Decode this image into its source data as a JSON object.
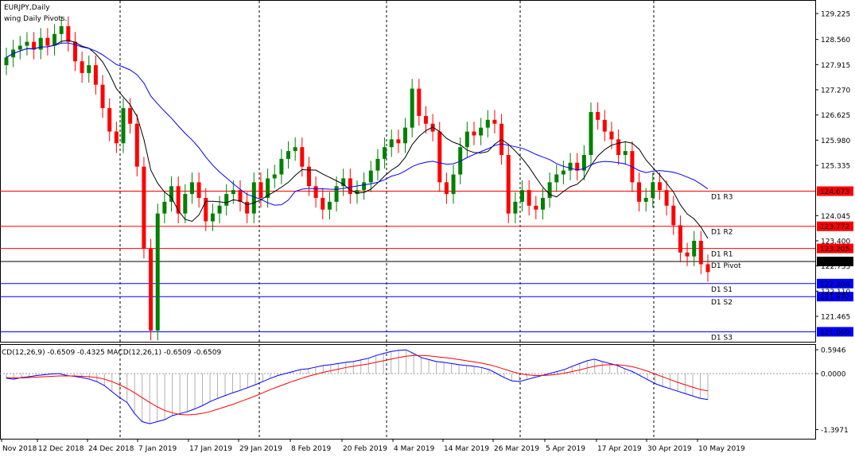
{
  "chart_data": [
    {
      "type": "candlestick",
      "title": "EURJPY,Daily",
      "subtitle": "wing Daily Pivots.",
      "price_axis": {
        "ticks": [
          "129.225",
          "128.560",
          "127.915",
          "127.270",
          "126.625",
          "125.980",
          "125.335",
          "124.045",
          "123.400",
          "122.755",
          "122.110",
          "121.465"
        ],
        "tick_values": [
          129.225,
          128.56,
          127.915,
          127.27,
          126.625,
          125.98,
          125.335,
          124.045,
          123.4,
          122.755,
          122.11,
          121.465
        ]
      },
      "date_axis": {
        "ticks": [
          "Nov 2018",
          "12 Dec 2018",
          "24 Dec 2018",
          "7 Jan 2019",
          "17 Jan 2019",
          "29 Jan 2019",
          "8 Feb 2019",
          "20 Feb 2019",
          "4 Mar 2019",
          "14 Mar 2019",
          "26 Mar 2019",
          "5 Apr 2019",
          "17 Apr 2019",
          "30 Apr 2019",
          "10 May 2019"
        ]
      },
      "pivot_levels": [
        {
          "name": "D1 R3",
          "value": 124.673,
          "price_label": "124.673",
          "color": "#ff0000"
        },
        {
          "name": "D1 R2",
          "value": 123.772,
          "price_label": "123.772",
          "color": "#ff0000"
        },
        {
          "name": "D1 R1",
          "value": 123.205,
          "price_label": "123.205",
          "color": "#ff0000"
        },
        {
          "name": "D1 Pivot",
          "value": 122.871,
          "price_label": "122.871",
          "color": "#000000"
        },
        {
          "name": "D1 S1",
          "value": 122.304,
          "price_label": "122.304",
          "color": "#0000ff"
        },
        {
          "name": "D1 S2",
          "value": 121.97,
          "price_label": "121.970",
          "color": "#0000ff"
        },
        {
          "name": "D1 S3",
          "value": 121.069,
          "price_label": "121.069",
          "color": "#0000ff"
        }
      ],
      "closes": [
        128.1,
        128.3,
        128.4,
        128.5,
        128.3,
        128.6,
        128.4,
        128.7,
        128.9,
        128.5,
        128.0,
        127.7,
        127.9,
        127.4,
        126.8,
        126.2,
        125.9,
        126.8,
        126.4,
        125.3,
        123.2,
        121.1,
        124.1,
        124.4,
        124.8,
        124.1,
        124.6,
        124.9,
        124.5,
        123.9,
        124.1,
        124.3,
        124.6,
        124.7,
        124.4,
        124.1,
        124.9,
        124.5,
        125.0,
        125.1,
        125.5,
        125.7,
        125.8,
        125.3,
        124.8,
        124.5,
        124.2,
        124.4,
        124.8,
        125.0,
        124.6,
        124.7,
        124.9,
        125.2,
        125.5,
        125.8,
        126.0,
        125.9,
        126.3,
        127.3,
        126.6,
        126.4,
        126.2,
        124.9,
        124.6,
        125.1,
        125.8,
        126.2,
        126.1,
        126.3,
        126.5,
        126.4,
        125.6,
        124.1,
        124.4,
        124.7,
        124.3,
        124.2,
        124.5,
        124.9,
        125.1,
        125.2,
        125.4,
        125.2,
        125.6,
        126.7,
        126.5,
        126.2,
        126.0,
        125.6,
        125.7,
        124.9,
        124.4,
        124.5,
        124.9,
        124.7,
        124.3,
        123.8,
        123.1,
        123.0,
        123.4,
        122.8,
        122.6
      ]
    },
    {
      "type": "macd",
      "header": "CD(12,26,9) -0.6509 -0.4325 MACD(12,26,1) -0.6509 -0.6509",
      "axis": {
        "ticks": [
          "0.5946",
          "0.0000",
          "-1.3971"
        ],
        "tick_values": [
          0.5946,
          0.0,
          -1.3971
        ]
      },
      "macd_line_color": "#0000ff",
      "signal_line_color": "#ff0000",
      "histogram": [
        -0.12,
        -0.14,
        -0.1,
        -0.08,
        -0.05,
        -0.03,
        -0.01,
        0.0,
        -0.05,
        -0.07,
        -0.1,
        -0.14,
        -0.2,
        -0.3,
        -0.45,
        -0.6,
        -0.72,
        -1.0,
        -1.2,
        -1.25,
        -1.2,
        -1.15,
        -1.05,
        -1.0,
        -0.95,
        -0.88,
        -0.8,
        -0.7,
        -0.62,
        -0.55,
        -0.48,
        -0.42,
        -0.35,
        -0.28,
        -0.2,
        -0.12,
        -0.05,
        0.0,
        0.05,
        0.1,
        0.12,
        0.16,
        0.2,
        0.22,
        0.25,
        0.28,
        0.3,
        0.34,
        0.38,
        0.45,
        0.5,
        0.55,
        0.58,
        0.59,
        0.5,
        0.4,
        0.35,
        0.3,
        0.28,
        0.25,
        0.22,
        0.2,
        0.18,
        0.15,
        0.1,
        0.0,
        -0.1,
        -0.18,
        -0.2,
        -0.15,
        -0.1,
        -0.05,
        0.0,
        0.05,
        0.1,
        0.18,
        0.25,
        0.32,
        0.36,
        0.3,
        0.25,
        0.2,
        0.12,
        0.05,
        -0.05,
        -0.15,
        -0.25,
        -0.32,
        -0.38,
        -0.44,
        -0.5,
        -0.56,
        -0.62,
        -0.65
      ],
      "macd": [
        -0.12,
        -0.14,
        -0.1,
        -0.08,
        -0.05,
        -0.03,
        -0.01,
        0.0,
        -0.05,
        -0.07,
        -0.1,
        -0.14,
        -0.2,
        -0.3,
        -0.45,
        -0.6,
        -0.72,
        -1.0,
        -1.2,
        -1.25,
        -1.2,
        -1.15,
        -1.05,
        -1.0,
        -0.95,
        -0.88,
        -0.8,
        -0.7,
        -0.62,
        -0.55,
        -0.48,
        -0.42,
        -0.35,
        -0.28,
        -0.2,
        -0.12,
        -0.05,
        0.0,
        0.05,
        0.1,
        0.12,
        0.16,
        0.2,
        0.22,
        0.25,
        0.28,
        0.3,
        0.34,
        0.38,
        0.45,
        0.5,
        0.55,
        0.58,
        0.59,
        0.5,
        0.4,
        0.35,
        0.3,
        0.28,
        0.25,
        0.22,
        0.2,
        0.18,
        0.15,
        0.1,
        0.0,
        -0.1,
        -0.18,
        -0.2,
        -0.15,
        -0.1,
        -0.05,
        0.0,
        0.05,
        0.1,
        0.18,
        0.25,
        0.32,
        0.36,
        0.3,
        0.25,
        0.2,
        0.12,
        0.05,
        -0.05,
        -0.15,
        -0.25,
        -0.32,
        -0.38,
        -0.44,
        -0.5,
        -0.56,
        -0.62,
        -0.65
      ],
      "signal": [
        -0.1,
        -0.11,
        -0.11,
        -0.1,
        -0.09,
        -0.08,
        -0.07,
        -0.06,
        -0.06,
        -0.06,
        -0.07,
        -0.08,
        -0.1,
        -0.14,
        -0.2,
        -0.28,
        -0.37,
        -0.48,
        -0.6,
        -0.72,
        -0.83,
        -0.92,
        -0.98,
        -1.02,
        -1.03,
        -1.02,
        -0.99,
        -0.95,
        -0.89,
        -0.83,
        -0.77,
        -0.7,
        -0.63,
        -0.56,
        -0.48,
        -0.4,
        -0.33,
        -0.26,
        -0.19,
        -0.13,
        -0.07,
        -0.02,
        0.03,
        0.07,
        0.11,
        0.15,
        0.18,
        0.21,
        0.24,
        0.28,
        0.32,
        0.36,
        0.4,
        0.43,
        0.45,
        0.45,
        0.44,
        0.42,
        0.4,
        0.38,
        0.35,
        0.32,
        0.29,
        0.26,
        0.22,
        0.17,
        0.11,
        0.05,
        0.0,
        -0.03,
        -0.05,
        -0.05,
        -0.04,
        -0.02,
        0.01,
        0.05,
        0.09,
        0.14,
        0.18,
        0.21,
        0.22,
        0.22,
        0.2,
        0.17,
        0.12,
        0.06,
        -0.01,
        -0.08,
        -0.15,
        -0.22,
        -0.28,
        -0.34,
        -0.4,
        -0.43
      ]
    }
  ]
}
